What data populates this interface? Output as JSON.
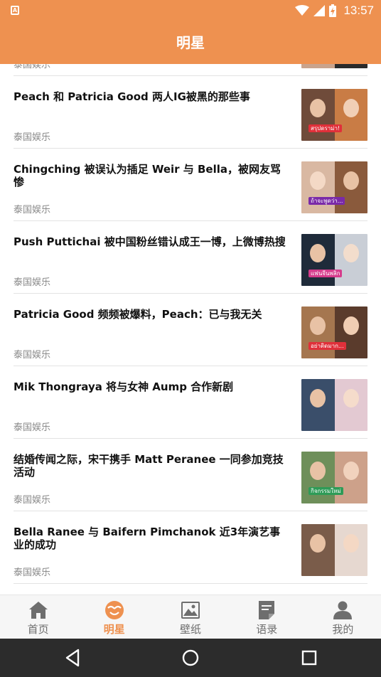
{
  "status_bar": {
    "time": "13:57",
    "notification_icon": "app-notification-icon",
    "icons": [
      "wifi-icon",
      "signal-icon",
      "battery-charging-icon"
    ]
  },
  "header": {
    "title": "明星"
  },
  "articles": [
    {
      "title": "",
      "category": "泰国娱乐"
    },
    {
      "title": "Peach 和 Patricia Good 两人IG被黑的那些事",
      "category": "泰国娱乐",
      "thumb_caption": "สรุปดราม่า!"
    },
    {
      "title": "Chingching 被误认为插足 Weir 与 Bella，被网友骂惨",
      "category": "泰国娱乐",
      "thumb_caption": "ถ้าจะพูดว่า..."
    },
    {
      "title": "Push Puttichai 被中国粉丝错认成王一博，上微博热搜",
      "category": "泰国娱乐",
      "thumb_caption": "แฟนจีนพลิก"
    },
    {
      "title": "Patricia Good 频频被爆料，Peach：已与我无关",
      "category": "泰国娱乐",
      "thumb_caption": "อย่าติดมาก..."
    },
    {
      "title": "Mik Thongraya 将与女神 Aump 合作新剧",
      "category": "泰国娱乐",
      "thumb_caption": ""
    },
    {
      "title": "结婚传闻之际，宋干携手 Matt Peranee 一同参加竞技活动",
      "category": "泰国娱乐",
      "thumb_caption": "กิจกรรมใหม่"
    },
    {
      "title": "Bella Ranee 与 Baifern Pimchanok 近3年演艺事业的成功",
      "category": "泰国娱乐",
      "thumb_caption": ""
    }
  ],
  "bottom_nav": [
    {
      "label": "首页",
      "icon": "home-icon",
      "active": false
    },
    {
      "label": "明星",
      "icon": "star-face-icon",
      "active": true
    },
    {
      "label": "壁纸",
      "icon": "wallpaper-image-icon",
      "active": false
    },
    {
      "label": "语录",
      "icon": "quotes-document-icon",
      "active": false
    },
    {
      "label": "我的",
      "icon": "profile-person-icon",
      "active": false
    }
  ],
  "system_nav": [
    "back-icon",
    "home-circle-icon",
    "recents-icon"
  ],
  "colors": {
    "accent": "#ee9150",
    "title_text": "#111111",
    "category_text": "#8a8a8a",
    "nav_inactive": "#6e6e6e",
    "system_bar": "#2c2c2c"
  }
}
